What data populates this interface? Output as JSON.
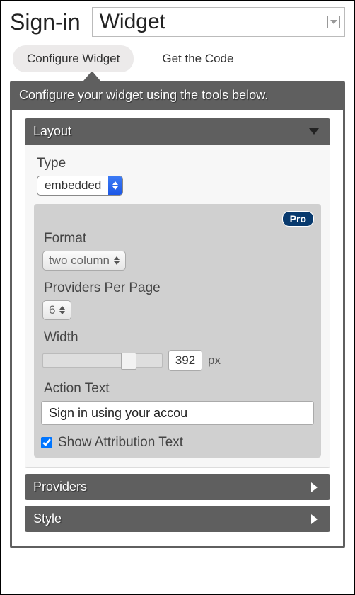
{
  "header": {
    "title": "Sign-in",
    "select_value": "Widget"
  },
  "tabs": {
    "configure": "Configure Widget",
    "getcode": "Get the Code"
  },
  "panel": {
    "intro": "Configure your widget using the tools below."
  },
  "accordion": {
    "layout": {
      "title": "Layout",
      "type_label": "Type",
      "type_value": "embedded",
      "pro_badge": "Pro",
      "format_label": "Format",
      "format_value": "two column",
      "ppp_label": "Providers Per Page",
      "ppp_value": "6",
      "width_label": "Width",
      "width_value": "392",
      "width_unit": "px",
      "action_label": "Action Text",
      "action_value": "Sign in using your accou",
      "show_attr_label": "Show Attribution Text",
      "show_attr_checked": true
    },
    "providers": {
      "title": "Providers"
    },
    "style": {
      "title": "Style"
    }
  }
}
